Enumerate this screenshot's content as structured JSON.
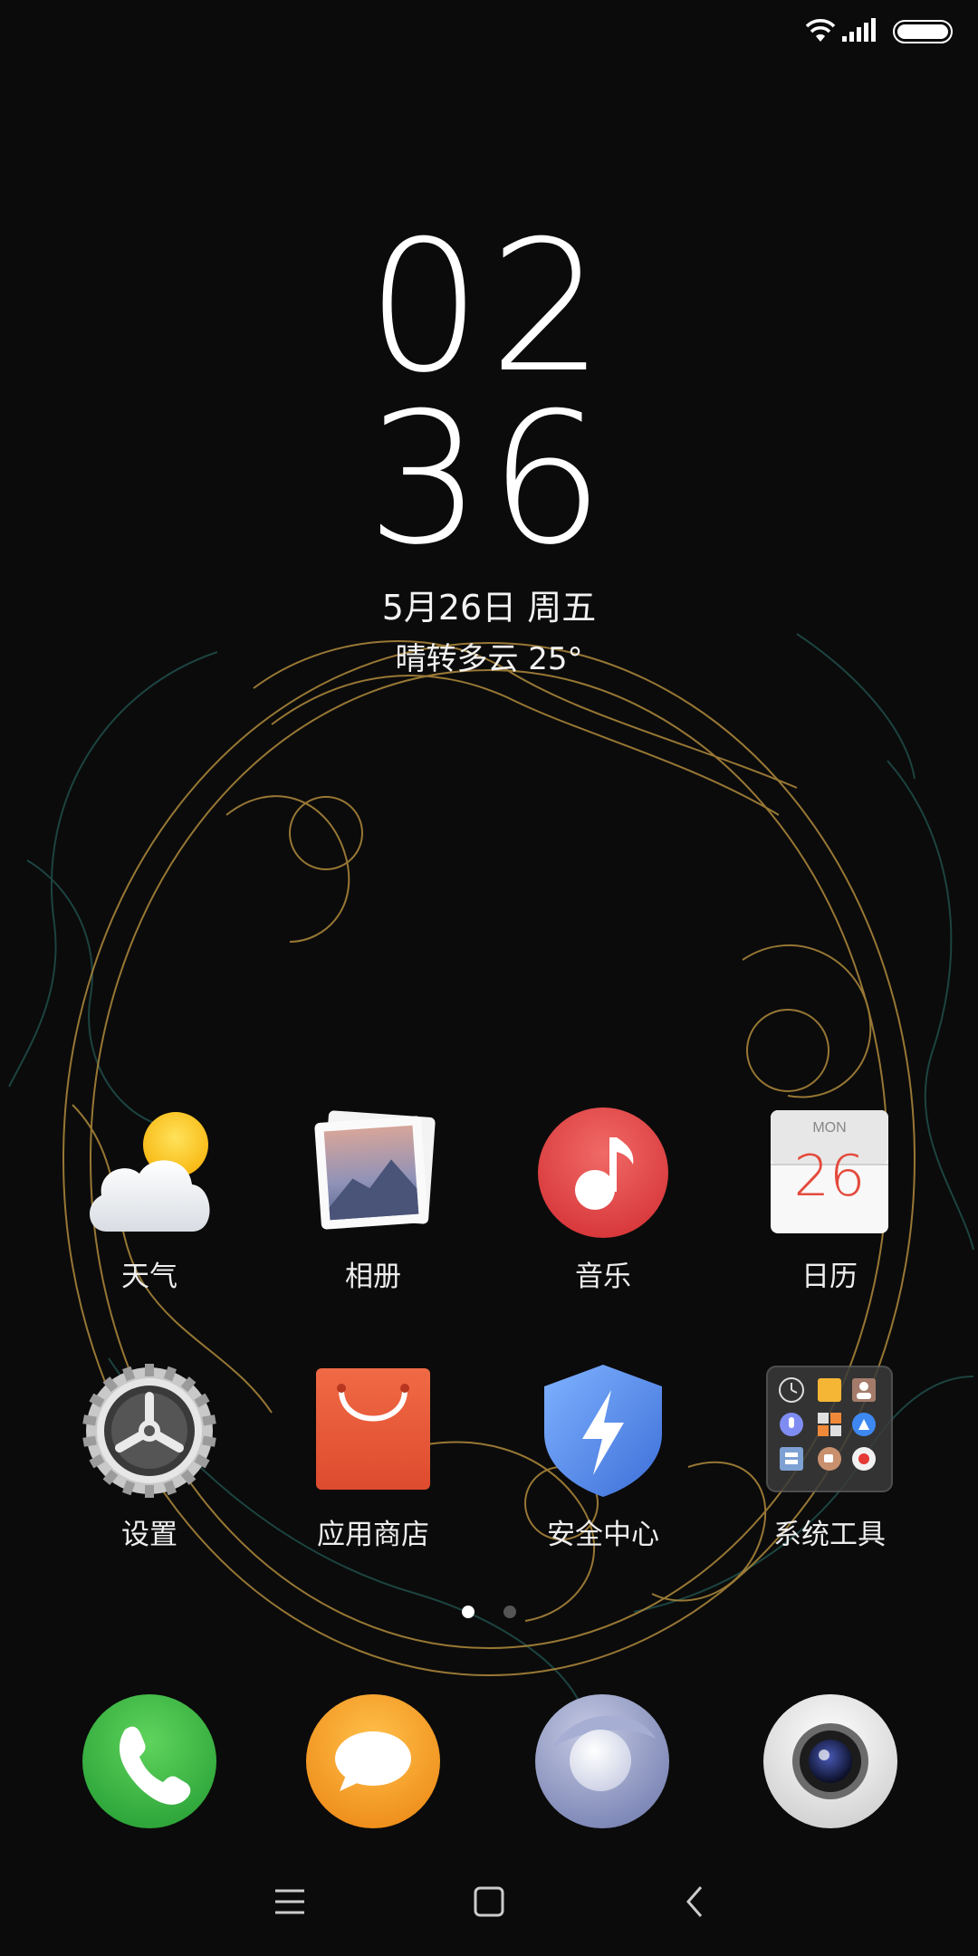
{
  "status_bar": {
    "wifi_icon": "wifi-icon",
    "signal_icon": "signal-icon",
    "battery_icon": "battery-icon"
  },
  "clock": {
    "hour": "02",
    "minute": "36",
    "date": "5月26日 周五",
    "weather": "晴转多云  25°"
  },
  "apps_row1": [
    {
      "label": "天气",
      "icon": "weather-icon"
    },
    {
      "label": "相册",
      "icon": "gallery-icon"
    },
    {
      "label": "音乐",
      "icon": "music-icon"
    },
    {
      "label": "日历",
      "icon": "calendar-icon",
      "day": "MON",
      "date": "26"
    }
  ],
  "apps_row2": [
    {
      "label": "设置",
      "icon": "settings-icon"
    },
    {
      "label": "应用商店",
      "icon": "app-store-icon"
    },
    {
      "label": "安全中心",
      "icon": "security-icon"
    },
    {
      "label": "系统工具",
      "icon": "system-tools-folder-icon"
    }
  ],
  "page_indicator": {
    "current": 1,
    "total": 2
  },
  "dock": [
    {
      "icon": "phone-icon"
    },
    {
      "icon": "messages-icon"
    },
    {
      "icon": "browser-icon"
    },
    {
      "icon": "camera-icon"
    }
  ],
  "nav_bar": {
    "menu_icon": "menu-icon",
    "home_icon": "home-icon",
    "back_icon": "back-icon"
  },
  "colors": {
    "background": "#0b0b0b",
    "gold_line": "#b08a3c",
    "teal_line": "#1e4a46",
    "phone_green": "#3cb64a",
    "messages_orange": "#f4a12a",
    "music_red": "#e44b4b",
    "store_orange": "#e9593a",
    "security_blue": "#4e86e8"
  }
}
